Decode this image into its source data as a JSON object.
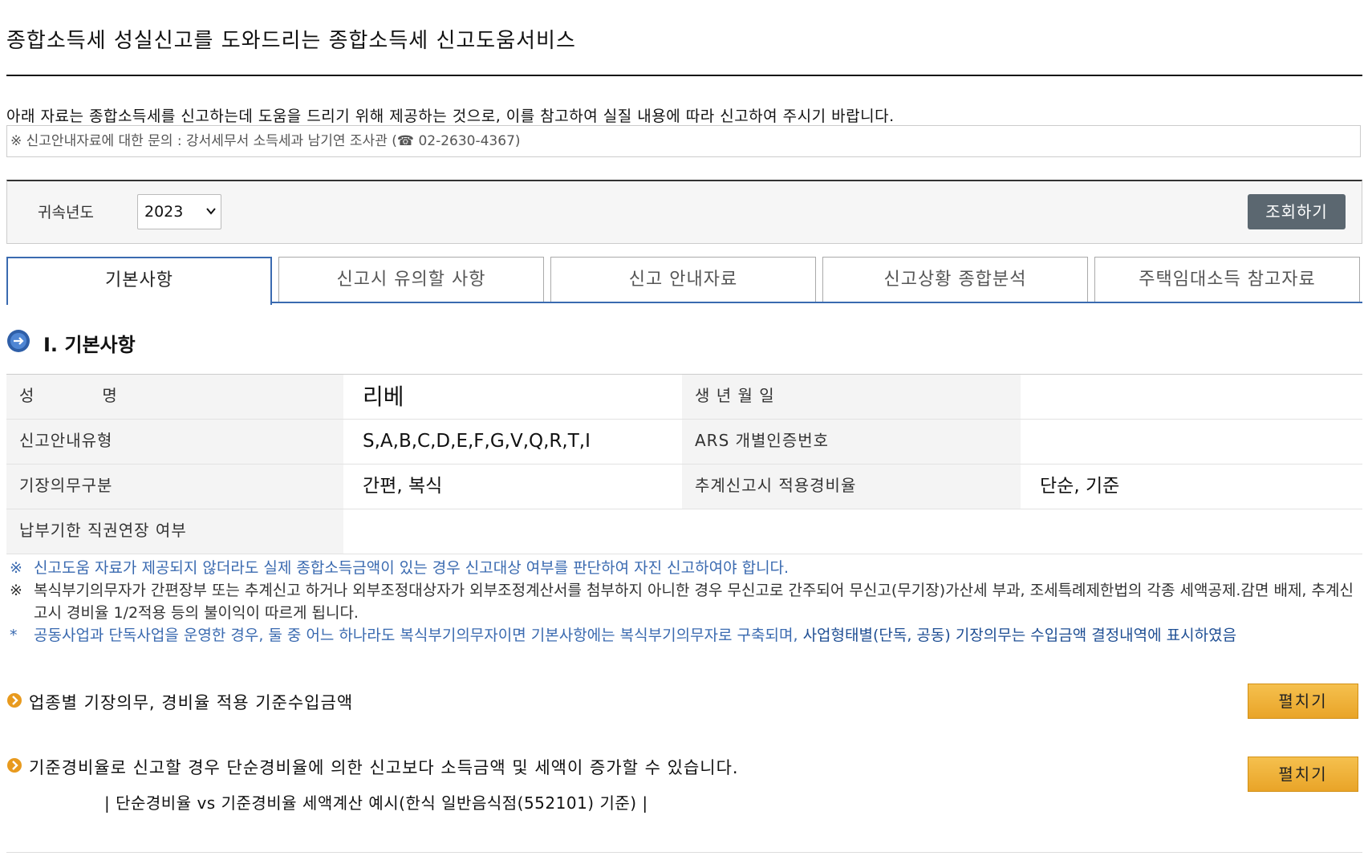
{
  "page": {
    "title": "종합소득세 성실신고를 도와드리는 종합소득세 신고도움서비스",
    "intro": "아래 자료는 종합소득세를 신고하는데 도움을 드리기 위해 제공하는 것으로, 이를 참고하여 실질 내용에 따라 신고하여 주시기 바랍니다.",
    "contact": "※ 신고안내자료에 대한 문의 : 강서세무서 소득세과 남기연 조사관 (☎ 02-2630-4367)"
  },
  "search": {
    "year_label": "귀속년도",
    "year_value": "2023",
    "query_label": "조회하기"
  },
  "tabs": [
    {
      "label": "기본사항",
      "active": true
    },
    {
      "label": "신고시 유의할 사항",
      "active": false
    },
    {
      "label": "신고 안내자료",
      "active": false
    },
    {
      "label": "신고상황 종합분석",
      "active": false
    },
    {
      "label": "주택임대소득 참고자료",
      "active": false
    }
  ],
  "section": {
    "title": "Ⅰ. 기본사항",
    "icon": "arrow-right-circle-icon"
  },
  "basic_info": {
    "name_label": "성　　　　명",
    "name_value": "리베",
    "birth_label": "생 년 월 일",
    "birth_value": "",
    "guide_type_label": "신고안내유형",
    "guide_type_value": "S,A,B,C,D,E,F,G,V,Q,R,T,I",
    "ars_label": "ARS 개별인증번호",
    "ars_value": "",
    "bookkeeping_label": "기장의무구분",
    "bookkeeping_value": "간편, 복식",
    "estimate_rate_label": "추계신고시 적용경비율",
    "estimate_rate_value": "단순, 기준",
    "deadline_ext_label": "납부기한 직권연장 여부",
    "deadline_ext_value": ""
  },
  "notes": [
    {
      "mark": "※",
      "text": "신고도움 자료가 제공되지 않더라도 실제 종합소득금액이 있는 경우 신고대상 여부를 판단하여 자진 신고하여야 합니다."
    },
    {
      "mark": "※",
      "text": "복식부기의무자가 간편장부 또는 추계신고 하거나 외부조정대상자가 외부조정계산서를 첨부하지 아니한 경우 무신고로 간주되어 무신고(무기장)가산세 부과, 조세특례제한법의 각종 세액공제.감면 배제, 추계신고시 경비율 1/2적용 등의 불이익이 따르게 됩니다."
    },
    {
      "mark": "*",
      "text": "공동사업과 단독사업을 운영한 경우, 둘 중 어느 하나라도 복식부기의무자이면 기본사항에는 복식부기의무자로 구축되며, ",
      "strong": "사업형태별(단독, 공동) 기장의무는 수입금액 결정내역에 표시하였음"
    }
  ],
  "subsections": [
    {
      "title": "업종별 기장의무, 경비율 적용 기준수입금액",
      "button_label": "펼치기"
    },
    {
      "title": "기준경비율로 신고할 경우 단순경비율에 의한 신고보다 소득금액 및 세액이 증가할 수 있습니다.",
      "button_label": "펼치기"
    }
  ],
  "example_caption": "| 단순경비율 vs 기준경비율 세액계산 예시(한식 일반음식점(552101) 기준) |",
  "colors": {
    "tab_accent": "#3a6ab0",
    "note_blue": "#3a6ab0",
    "button_gray": "#5b6770",
    "button_orange": "#efb43a"
  }
}
